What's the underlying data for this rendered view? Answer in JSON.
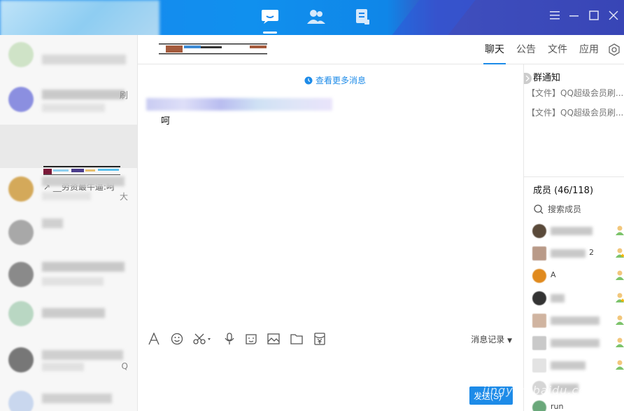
{
  "topbar": {
    "nav": [
      {
        "name": "chat-bubble-icon",
        "active": true
      },
      {
        "name": "contacts-icon",
        "active": false
      },
      {
        "name": "notes-icon",
        "active": false
      }
    ],
    "window_controls": [
      "menu-icon",
      "minimize-icon",
      "maximize-icon",
      "close-icon"
    ]
  },
  "leftlist": {
    "selected_preview": "__劳资最牛逼:呵",
    "side_tag_1": "刷",
    "side_tag_2": "大",
    "side_tag_3": "Q"
  },
  "chat": {
    "tabs": [
      "聊天",
      "公告",
      "文件",
      "应用"
    ],
    "active_tab": "聊天",
    "more_messages": "查看更多消息",
    "message_text": "呵"
  },
  "toolbar": {
    "history_label": "消息记录",
    "send_label": "发送(S)"
  },
  "rightpanel": {
    "notice_title": "群通知",
    "notices": [
      "【文件】QQ超级会员刷...",
      "【文件】QQ超级会员刷..."
    ],
    "members_title": "成员 (46/118)",
    "search_placeholder": "搜索成员",
    "member_partial_1": "A",
    "member_partial_2": "2",
    "member_last": "run"
  },
  "watermark": "jingyan.baidu.com",
  "colors": {
    "accent": "#1d8be8",
    "topbar_blue": "#1a86ee",
    "topbar_dark": "#3845b6"
  }
}
